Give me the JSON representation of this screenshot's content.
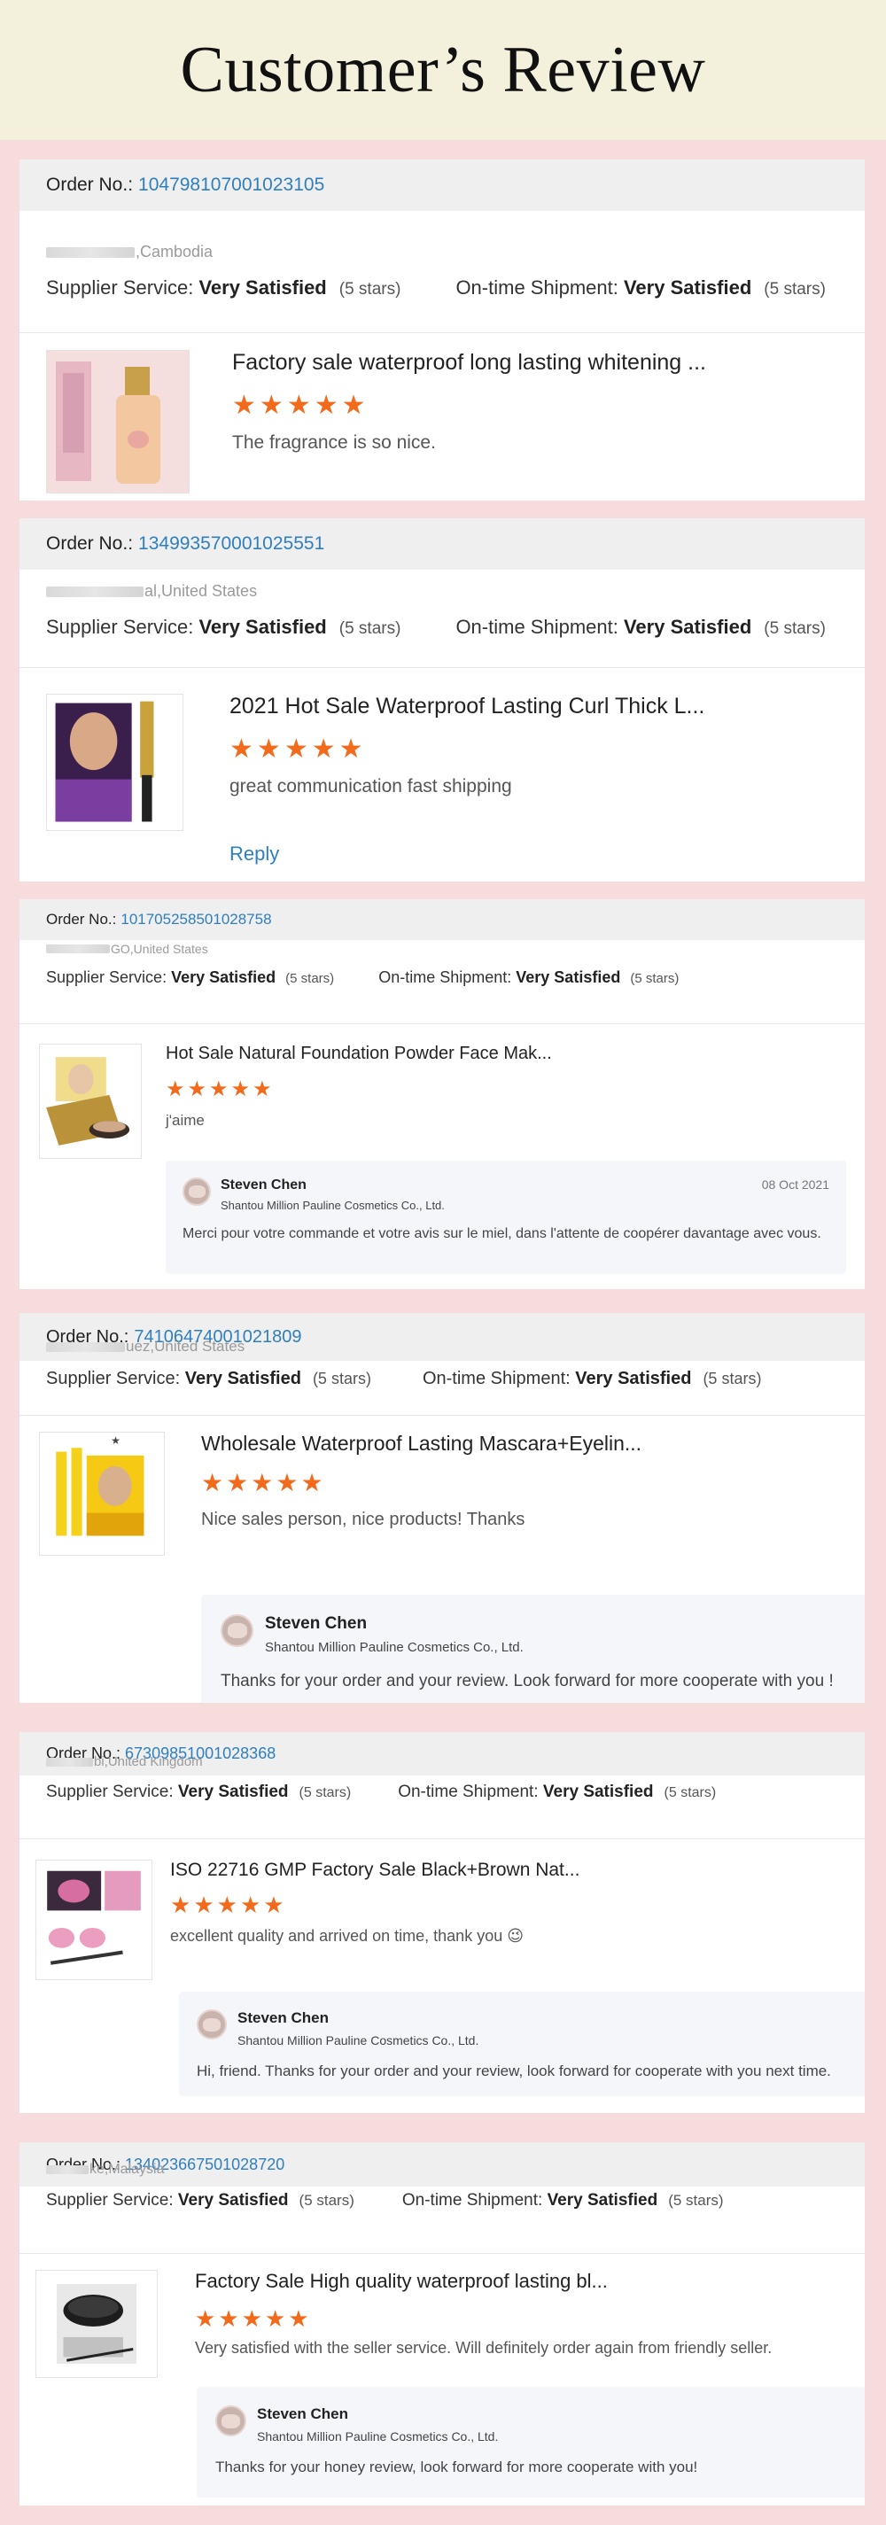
{
  "page_title": "Customer’s Review",
  "labels": {
    "order_no": "Order No.:",
    "supplier_service": "Supplier Service:",
    "on_time_shipment": "On-time Shipment:"
  },
  "reviews": [
    {
      "order_no": "104798107001023105",
      "buyer_location": ",Cambodia",
      "supplier_rating": "Very Satisfied",
      "supplier_stars": "(5 stars)",
      "shipment_rating": "Very Satisfied",
      "shipment_stars": "(5 stars)",
      "product_title": "Factory sale waterproof long lasting whitening ...",
      "stars": 5,
      "comment": "The fragrance is so nice."
    },
    {
      "order_no": "134993570001025551",
      "buyer_location": "al,United States",
      "supplier_rating": "Very Satisfied",
      "supplier_stars": "(5 stars)",
      "shipment_rating": "Very Satisfied",
      "shipment_stars": "(5 stars)",
      "product_title": "2021 Hot Sale Waterproof Lasting Curl Thick L...",
      "stars": 5,
      "comment": "great communication fast shipping",
      "reply_link": "Reply"
    },
    {
      "order_no": "101705258501028758",
      "buyer_location": "GO,United States",
      "supplier_rating": "Very Satisfied",
      "supplier_stars": "(5 stars)",
      "shipment_rating": "Very Satisfied",
      "shipment_stars": "(5 stars)",
      "product_title": "Hot Sale Natural Foundation Powder Face Mak...",
      "stars": 5,
      "comment": "j'aime",
      "reply": {
        "name": "Steven Chen",
        "company": "Shantou Million Pauline Cosmetics Co., Ltd.",
        "date": "08 Oct 2021",
        "text": "Merci pour votre commande et votre avis sur le miel, dans l'attente de coopérer davantage avec vous."
      }
    },
    {
      "order_no": "74106474001021809",
      "buyer_location": "uez,United States",
      "supplier_rating": "Very Satisfied",
      "supplier_stars": "(5 stars)",
      "shipment_rating": "Very Satisfied",
      "shipment_stars": "(5 stars)",
      "product_title": "Wholesale Waterproof Lasting Mascara+Eyelin...",
      "stars": 5,
      "comment": "Nice sales person, nice products! Thanks",
      "reply": {
        "name": "Steven Chen",
        "company": "Shantou Million Pauline Cosmetics Co., Ltd.",
        "text": "Thanks for your order and your review. Look forward for more cooperate with you !"
      }
    },
    {
      "order_no": "67309851001028368",
      "buyer_location": "bi,United Kingdom",
      "supplier_rating": "Very Satisfied",
      "supplier_stars": "(5 stars)",
      "shipment_rating": "Very Satisfied",
      "shipment_stars": "(5 stars)",
      "product_title": "ISO 22716 GMP Factory Sale Black+Brown Nat...",
      "stars": 5,
      "comment": "excellent quality and arrived on time, thank you 😉",
      "reply": {
        "name": "Steven Chen",
        "company": "Shantou Million Pauline Cosmetics Co., Ltd.",
        "text": "Hi, friend. Thanks for your order and your review, look forward for cooperate with you next time."
      }
    },
    {
      "order_no": "134023667501028720",
      "buyer_location": "ke,Malaysia",
      "supplier_rating": "Very Satisfied",
      "supplier_stars": "(5 stars)",
      "shipment_rating": "Very Satisfied",
      "shipment_stars": "(5 stars)",
      "product_title": "Factory Sale High quality waterproof lasting bl...",
      "stars": 5,
      "comment": "Very satisfied with the seller service. Will definitely order again from friendly seller.",
      "reply": {
        "name": "Steven Chen",
        "company": "Shantou Million Pauline Cosmetics Co., Ltd.",
        "text": "Thanks for your honey review, look forward for more cooperate with you!"
      }
    }
  ],
  "colors": {
    "page_background": "#f6dcdc",
    "header_background": "#f3f0dc",
    "order_number": "#2f7fc0",
    "star": "#f26a1b",
    "reply_background": "#f4f6f9"
  }
}
